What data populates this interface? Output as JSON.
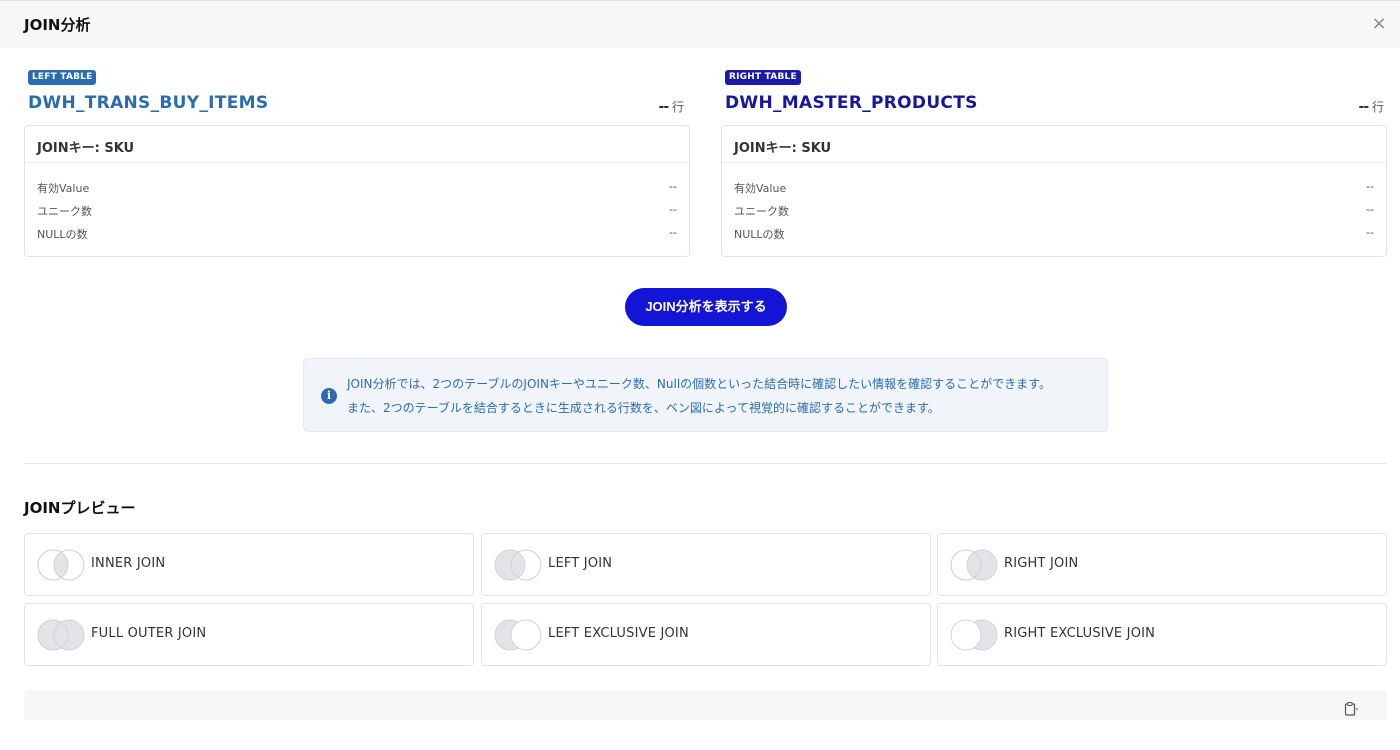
{
  "header": {
    "title": "JOIN分析",
    "close_symbol": "×"
  },
  "left_table": {
    "badge": "LEFT TABLE",
    "name": "DWH_TRANS_BUY_ITEMS",
    "row_count": "--",
    "row_unit": "行",
    "join_key": "JOINキー: SKU",
    "stats": [
      {
        "label": "有効Value",
        "value": "--"
      },
      {
        "label": "ユニーク数",
        "value": "--"
      },
      {
        "label": "NULLの数",
        "value": "--"
      }
    ]
  },
  "right_table": {
    "badge": "RIGHT TABLE",
    "name": "DWH_MASTER_PRODUCTS",
    "row_count": "--",
    "row_unit": "行",
    "join_key": "JOINキー: SKU",
    "stats": [
      {
        "label": "有効Value",
        "value": "--"
      },
      {
        "label": "ユニーク数",
        "value": "--"
      },
      {
        "label": "NULLの数",
        "value": "--"
      }
    ]
  },
  "analyze_button": "JOIN分析を表示する",
  "info": {
    "icon": "i",
    "line1": "JOIN分析では、2つのテーブルのJOINキーやユニーク数、Nullの個数といった結合時に確認したい情報を確認することができます。",
    "line2": "また、2つのテーブルを結合するときに生成される行数を、ベン図によって視覚的に確認することができます。"
  },
  "preview": {
    "title": "JOINプレビュー",
    "joins": [
      {
        "label": "INNER JOIN",
        "icon": "inner-join-venn-icon"
      },
      {
        "label": "LEFT JOIN",
        "icon": "left-join-venn-icon"
      },
      {
        "label": "RIGHT JOIN",
        "icon": "right-join-venn-icon"
      },
      {
        "label": "FULL OUTER JOIN",
        "icon": "full-outer-join-venn-icon"
      },
      {
        "label": "LEFT EXCLUSIVE JOIN",
        "icon": "left-exclusive-join-venn-icon"
      },
      {
        "label": "RIGHT EXCLUSIVE JOIN",
        "icon": "right-exclusive-join-venn-icon"
      }
    ]
  },
  "colors": {
    "left_accent": "#2b6cb0",
    "right_accent": "#17179e",
    "button": "#1414d6",
    "venn_fill": "#e2e4e8"
  }
}
